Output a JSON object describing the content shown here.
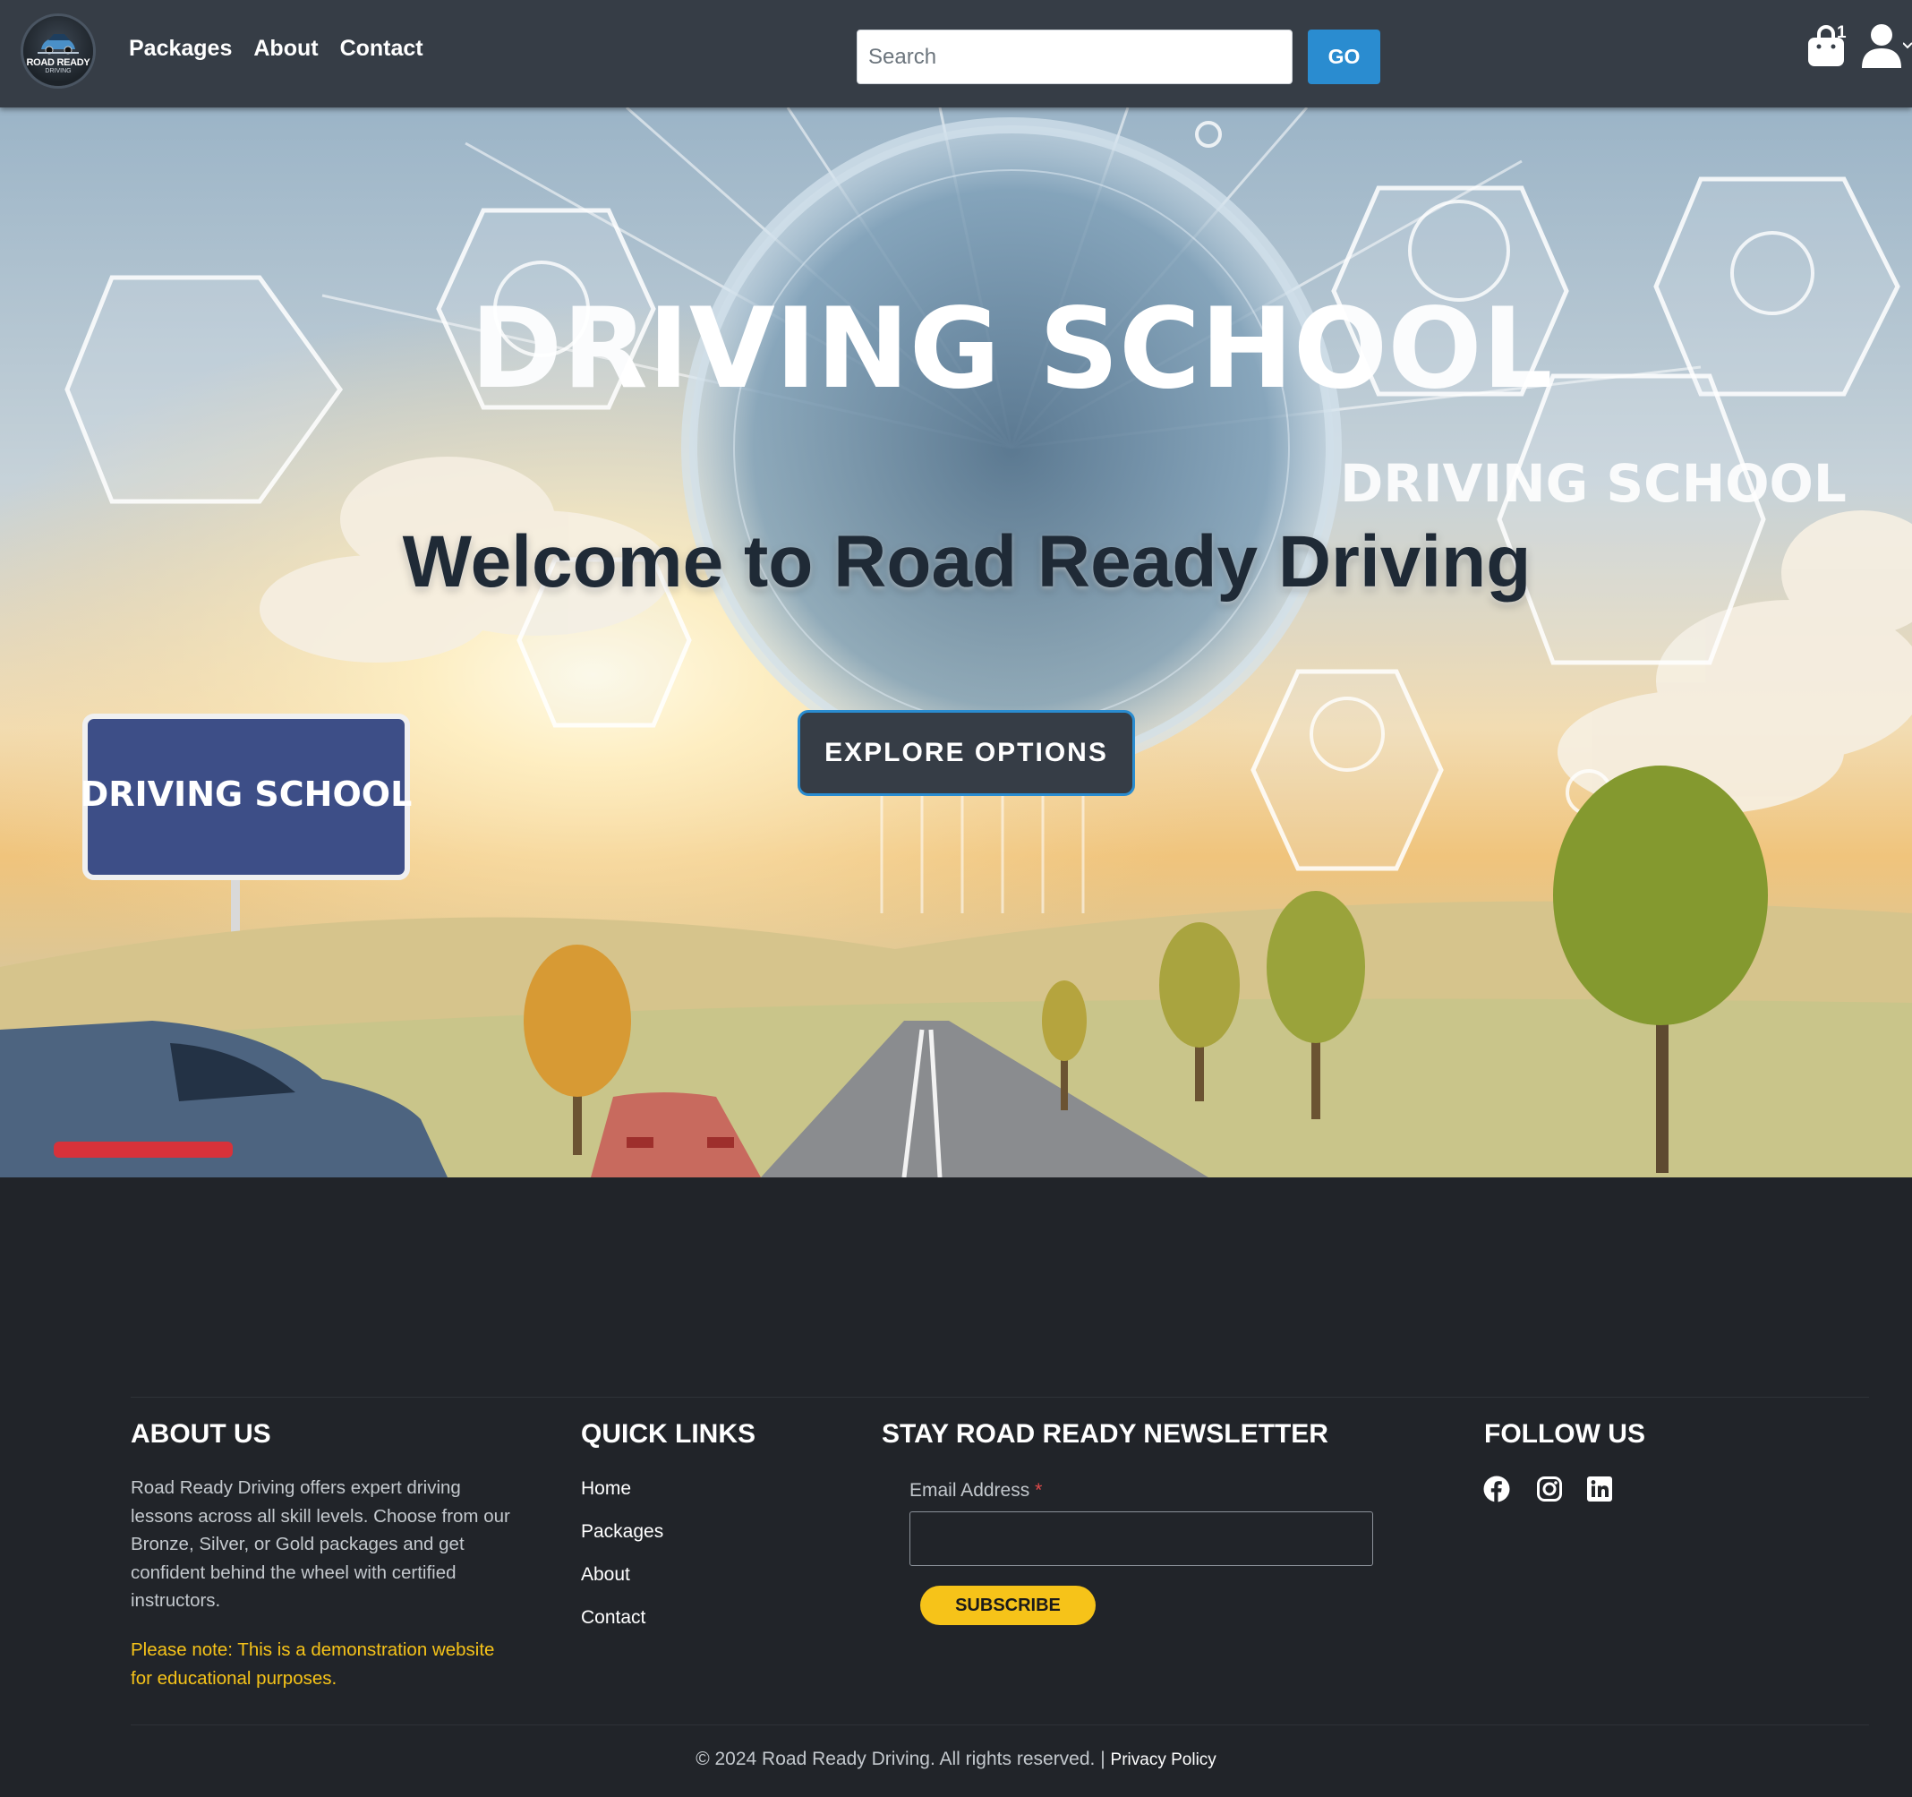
{
  "brand": {
    "logo_text": "ROAD READY",
    "logo_sub": "DRIVING"
  },
  "nav": {
    "links": [
      "Packages",
      "About",
      "Contact"
    ],
    "search_placeholder": "Search",
    "search_button": "GO",
    "cart_count": "1",
    "cart_icon": "shopping-bag-icon",
    "user_icon": "user-icon"
  },
  "hero": {
    "title": "Welcome to Road Ready Driving",
    "button": "EXPLORE OPTIONS",
    "image_text": {
      "center_sign": "DRIVING SCHOOL",
      "right_badge": "DRIVING SCHOOL",
      "left_sign": "DRIVING SCHOOL"
    }
  },
  "footer": {
    "about": {
      "heading": "ABOUT US",
      "text": "Road Ready Driving offers expert driving lessons across all skill levels. Choose from our Bronze, Silver, or Gold packages and get confident behind the wheel with certified instructors.",
      "note": "Please note: This is a demonstration website for educational purposes."
    },
    "quick_links": {
      "heading": "QUICK LINKS",
      "items": [
        "Home",
        "Packages",
        "About",
        "Contact"
      ]
    },
    "newsletter": {
      "heading": "STAY ROAD READY NEWSLETTER",
      "email_label": "Email Address",
      "required_mark": "*",
      "button": "SUBSCRIBE"
    },
    "follow": {
      "heading": "FOLLOW US",
      "icons": [
        "facebook-icon",
        "instagram-icon",
        "linkedin-icon"
      ]
    },
    "copyright": "© 2024 Road Ready Driving. All rights reserved.",
    "separator": "|",
    "privacy": "Privacy Policy"
  },
  "colors": {
    "navbar": "#363d46",
    "accent_blue": "#2a8cd0",
    "footer_bg": "#212429",
    "accent_yellow": "#f6c319"
  }
}
